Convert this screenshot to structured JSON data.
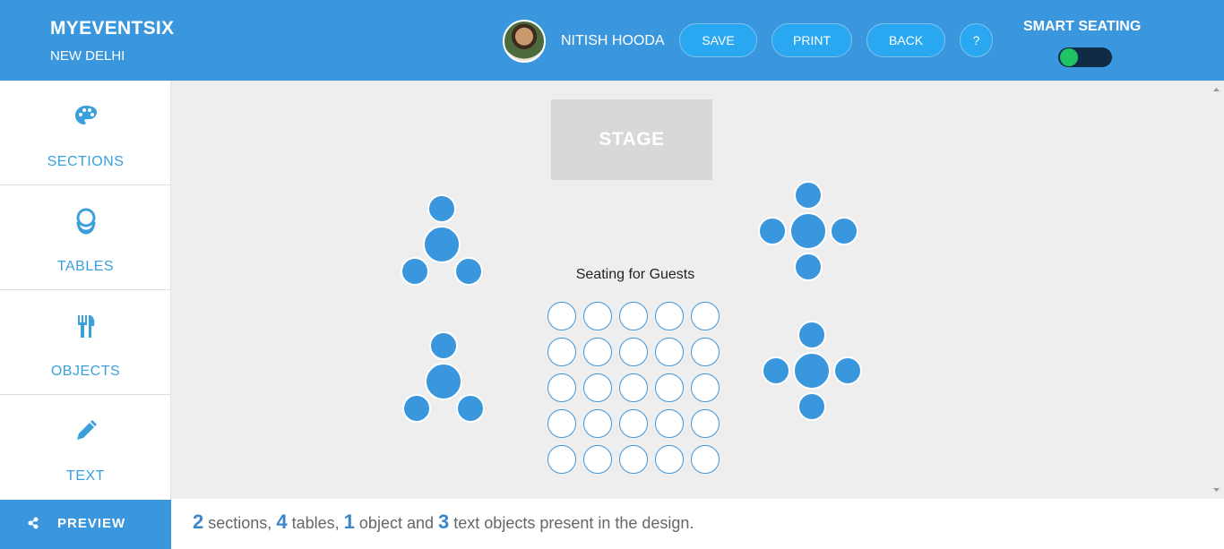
{
  "header": {
    "brand": "MYEVENTSIX",
    "city": "NEW DELHI",
    "user_name": "NITISH HOODA",
    "buttons": {
      "save": "SAVE",
      "print": "PRINT",
      "back": "BACK",
      "help": "?"
    },
    "smart_seating_label": "SMART SEATING",
    "smart_seating_on": true
  },
  "sidebar": {
    "items": [
      {
        "label": "SECTIONS",
        "icon": "palette-icon"
      },
      {
        "label": "TABLES",
        "icon": "tables-icon"
      },
      {
        "label": "OBJECTS",
        "icon": "cutlery-icon"
      },
      {
        "label": "TEXT",
        "icon": "pencil-icon"
      }
    ],
    "preview_label": "PREVIEW",
    "preview_icon": "share-icon"
  },
  "canvas": {
    "stage_label": "STAGE",
    "seating_title": "Seating for Guests"
  },
  "footer": {
    "sections_count": "2",
    "sections_word": "sections,",
    "tables_count": "4",
    "tables_word": "tables,",
    "objects_count": "1",
    "objects_word": "object and",
    "text_count": "3",
    "text_word": "text objects present in the design."
  },
  "colors": {
    "accent": "#3a96dd",
    "button": "#29a7f0",
    "toggle_on": "#1fc466"
  }
}
